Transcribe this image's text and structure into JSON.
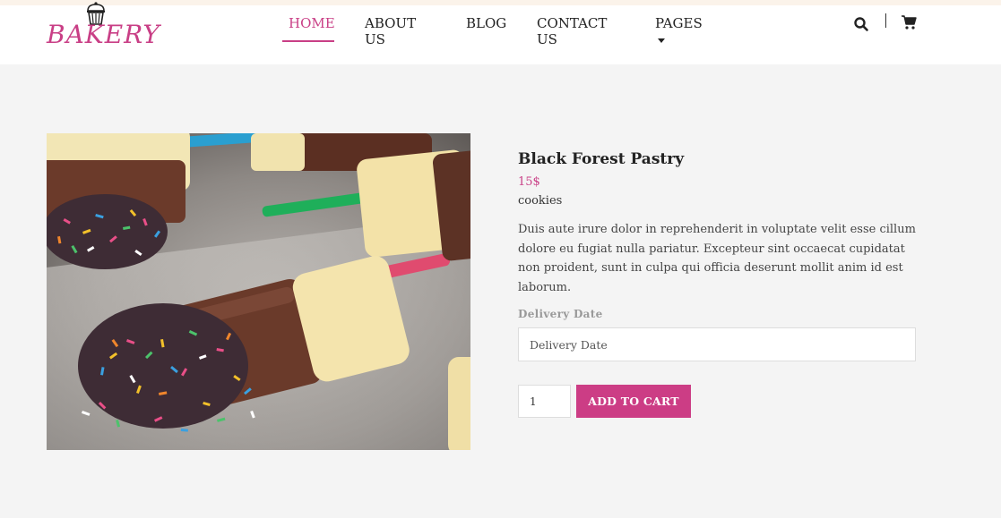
{
  "brand": {
    "logo_text": "BAKERY"
  },
  "nav": {
    "items": [
      {
        "label": "HOME"
      },
      {
        "label": "ABOUT US"
      },
      {
        "label": "BLOG"
      },
      {
        "label": "CONTACT US"
      },
      {
        "label": "PAGES"
      }
    ],
    "active": "HOME"
  },
  "header_icons": [
    "search-icon",
    "cart-icon"
  ],
  "product": {
    "name": "Black Forest Pastry",
    "price": "15$",
    "category": "cookies",
    "description": "Duis aute irure dolor in reprehenderit in voluptate velit esse cillum dolore eu fugiat nulla pariatur. Excepteur sint occaecat cupidatat non proident, sunt in culpa qui officia deserunt mollit anim id est laborum.",
    "delivery_label": "Delivery Date",
    "delivery_placeholder": "Delivery Date",
    "quantity": "1",
    "add_to_cart_label": "ADD TO CART"
  },
  "colors": {
    "accent": "#c93f86",
    "background": "#f4f4f4",
    "header": "#ffffff"
  }
}
